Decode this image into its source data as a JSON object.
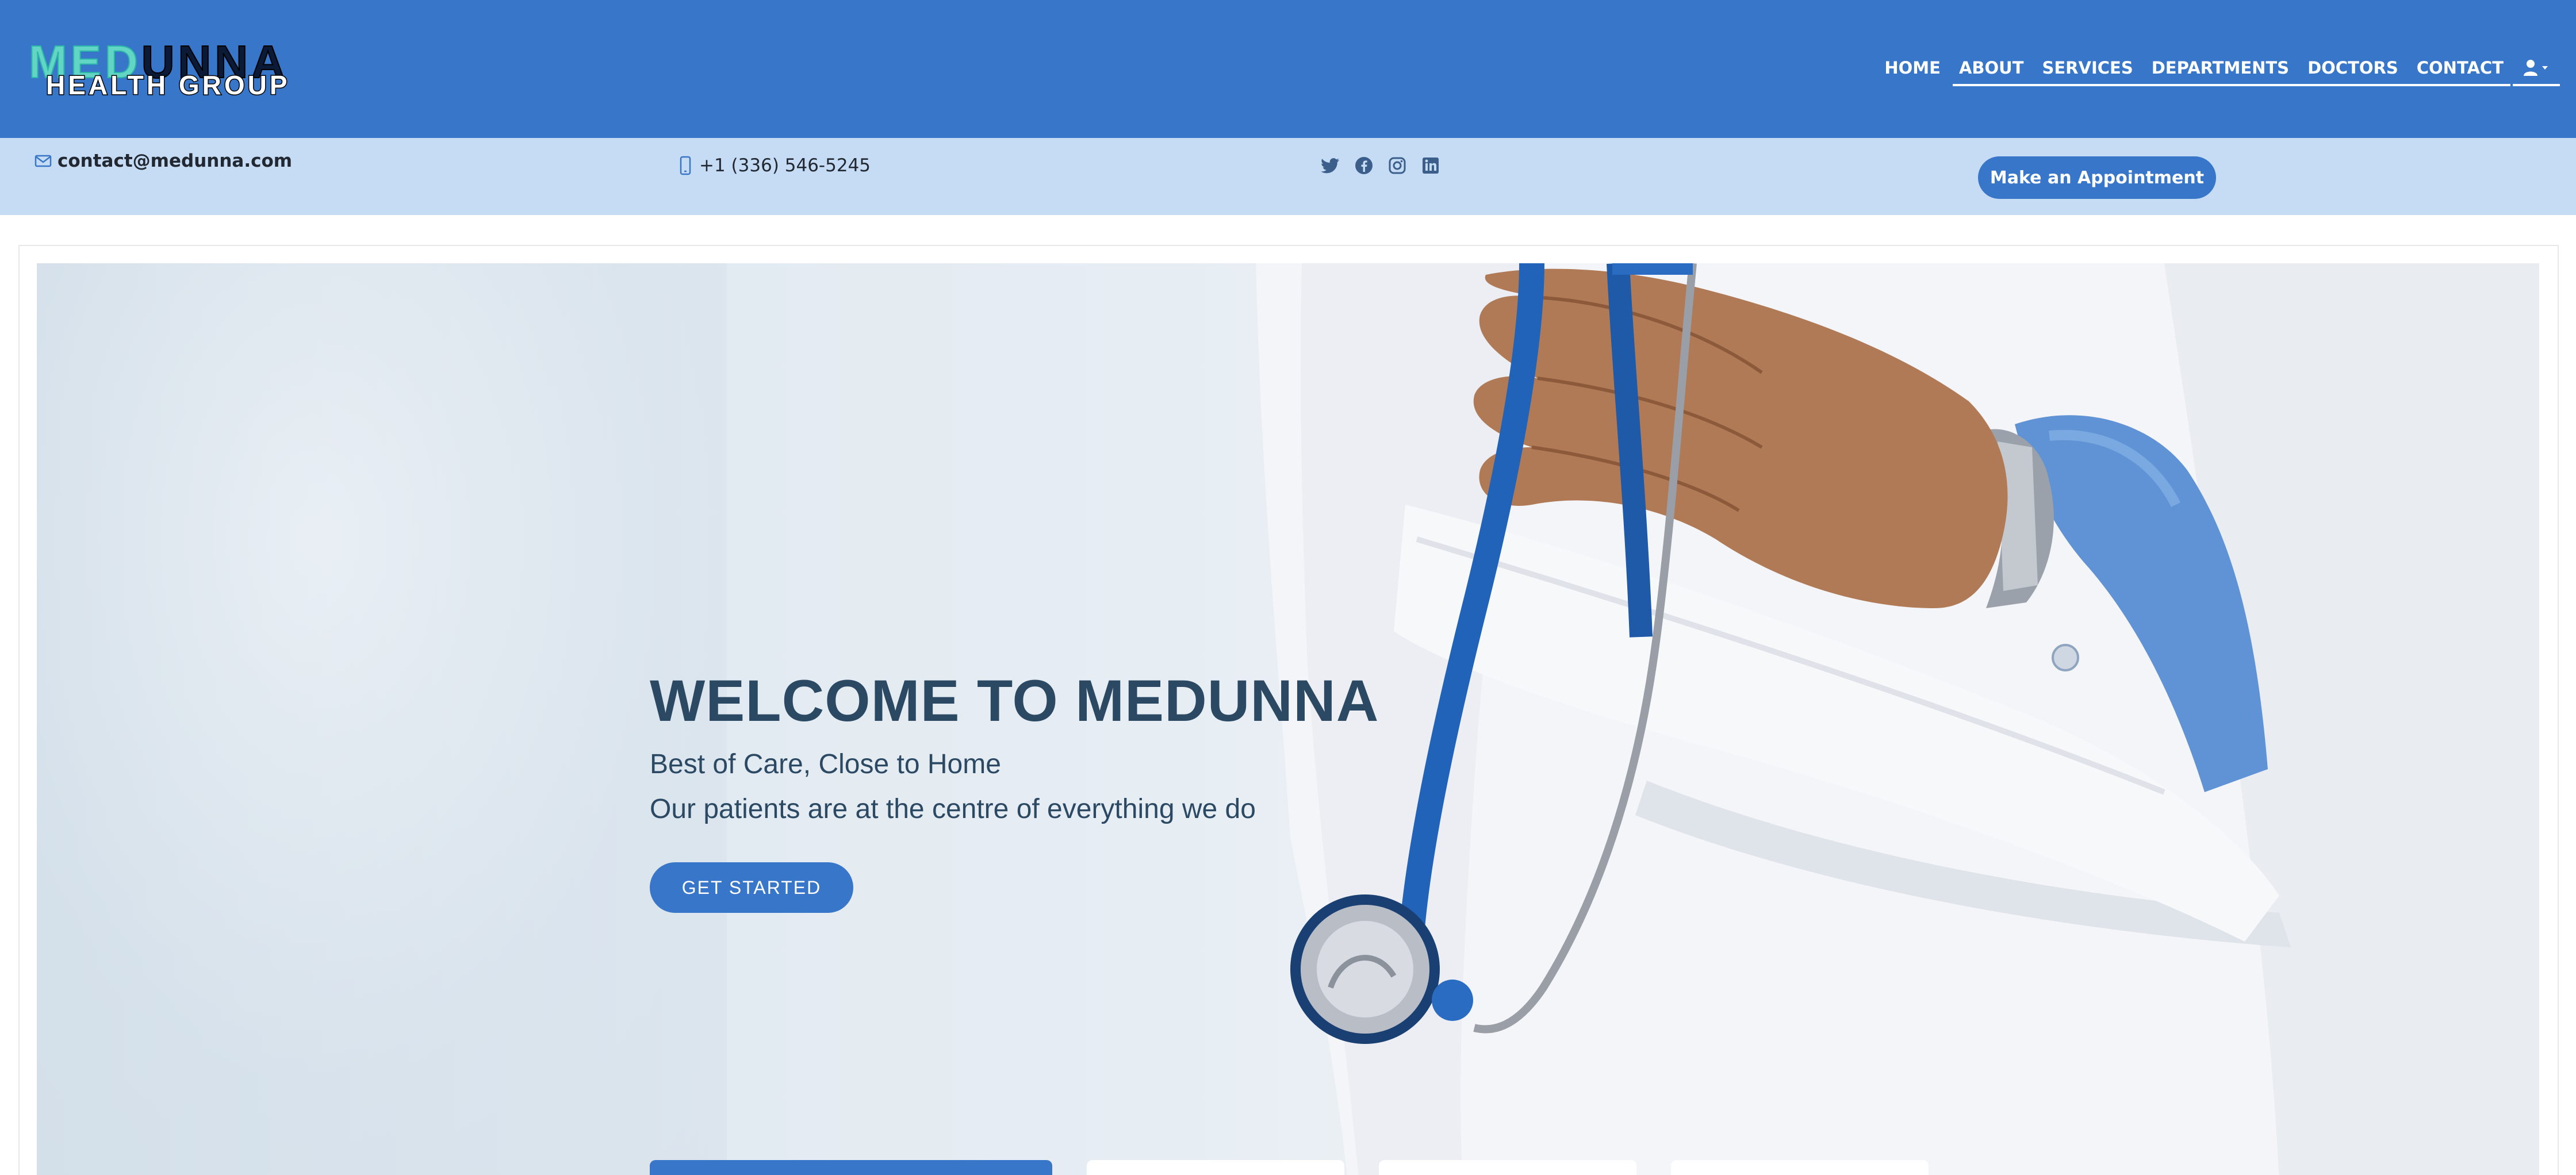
{
  "brand": {
    "logo_med": "MED",
    "logo_unna": "UNNA",
    "logo_tagline": "HEALTH GROUP"
  },
  "nav": {
    "items": [
      "HOME",
      "ABOUT",
      "SERVICES",
      "DEPARTMENTS",
      "DOCTORS",
      "CONTACT"
    ],
    "active": "HOME",
    "user_menu_icon": "user-icon"
  },
  "topbar": {
    "email": "contact@medunna.com",
    "email_icon": "envelope-icon",
    "phone": "+1 (336) 546-5245",
    "phone_icon": "phone-icon",
    "social": [
      "twitter-icon",
      "facebook-icon",
      "instagram-icon",
      "linkedin-icon"
    ],
    "appointment_label": "Make an Appointment"
  },
  "hero": {
    "title": "WELCOME TO MEDUNNA",
    "subtitle": "Best of Care, Close to Home",
    "tagline": "Our patients are at the centre of everything we do",
    "cta_label": "GET STARTED"
  },
  "colors": {
    "primary": "#3876c9",
    "topbar_bg": "#c6dcf4",
    "heading": "#2c4964",
    "logo_accent": "#63d5c4"
  }
}
